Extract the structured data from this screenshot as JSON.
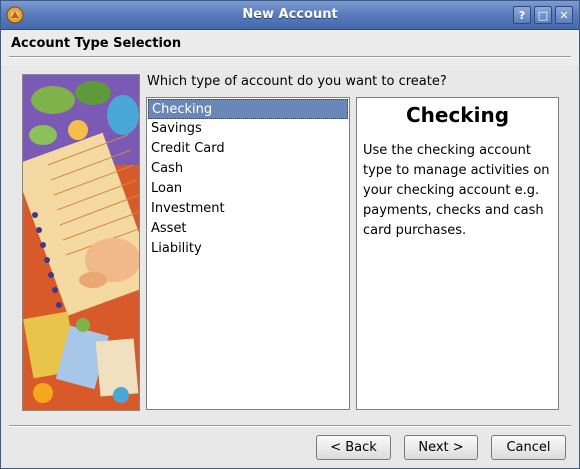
{
  "window": {
    "title": "New Account",
    "help_label": "?",
    "maximize_label": "□",
    "close_label": "✕"
  },
  "header": {
    "title": "Account Type Selection"
  },
  "illustration": {
    "icon": "illustration-image",
    "subject": "notebook-hands-cards-artwork"
  },
  "main": {
    "question": "Which type of account do you want to create?",
    "account_types": [
      {
        "label": "Checking",
        "selected": true
      },
      {
        "label": "Savings",
        "selected": false
      },
      {
        "label": "Credit Card",
        "selected": false
      },
      {
        "label": "Cash",
        "selected": false
      },
      {
        "label": "Loan",
        "selected": false
      },
      {
        "label": "Investment",
        "selected": false
      },
      {
        "label": "Asset",
        "selected": false
      },
      {
        "label": "Liability",
        "selected": false
      }
    ]
  },
  "description": {
    "title": "Checking",
    "body_lines": [
      "Use the checking account",
      "type to manage activities on",
      "your checking account e.g.",
      "payments, checks and cash",
      "card purchases."
    ]
  },
  "buttons": {
    "back_label": "< Back",
    "next_label": "Next >",
    "cancel_label": "Cancel"
  },
  "colors": {
    "titlebar": "#5a7dbd",
    "selection": "#6a87b8",
    "window_bg": "#e8e8e8"
  }
}
